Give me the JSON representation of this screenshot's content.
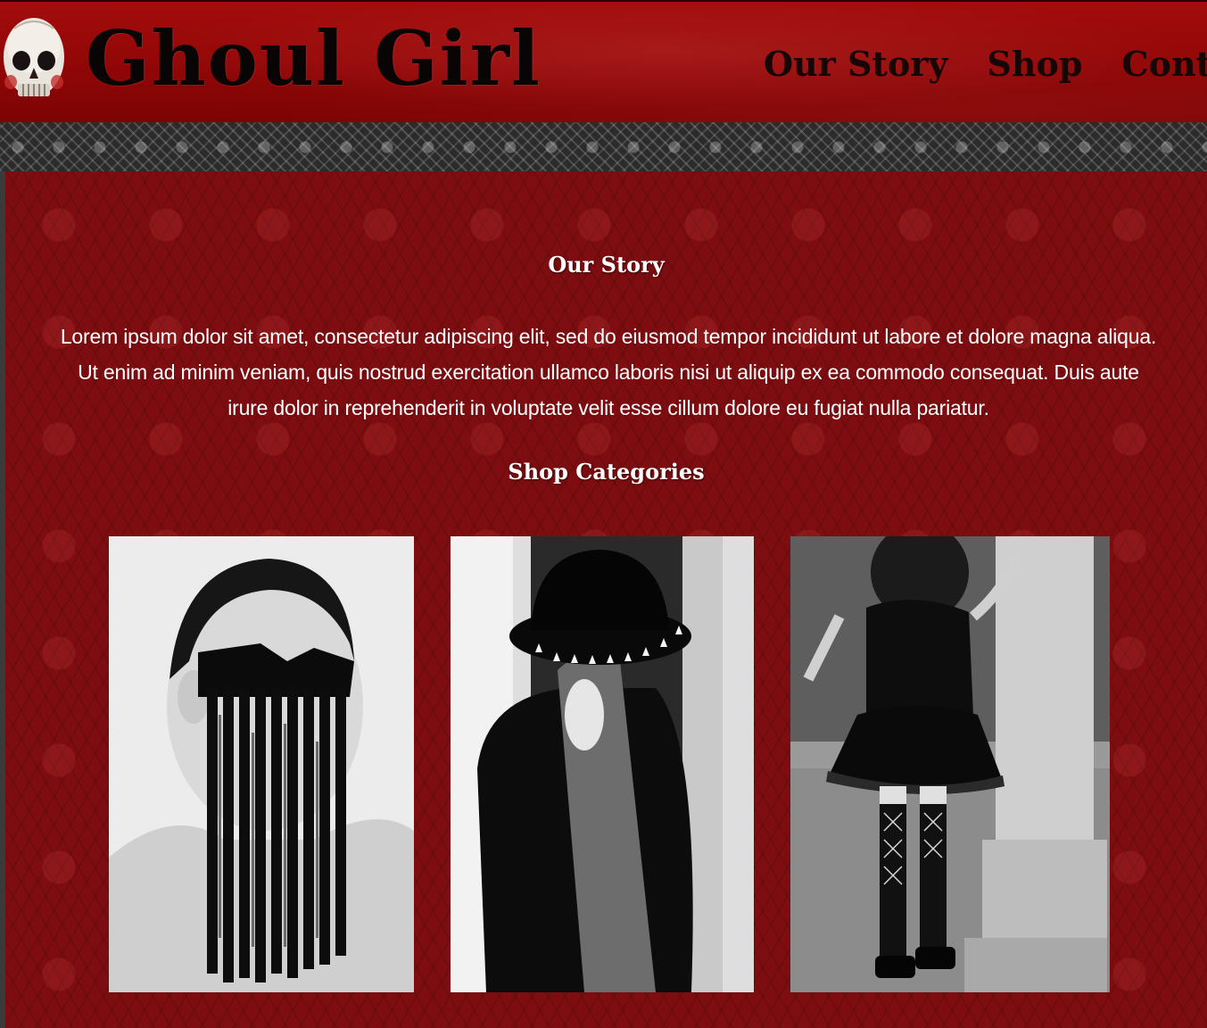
{
  "header": {
    "brand": "Ghoul Girl",
    "logo_icon": "skull-icon",
    "nav": [
      {
        "label": "Our Story"
      },
      {
        "label": "Shop"
      },
      {
        "label": "Contact"
      }
    ]
  },
  "colors": {
    "header_red": "#9a0808",
    "main_red": "#7d0d10",
    "band_grey": "#2b2b2b",
    "text_white": "#ffffff"
  },
  "story": {
    "title": "Our Story",
    "text": "Lorem ipsum dolor sit amet, consectetur adipiscing elit, sed do eiusmod tempor incididunt ut labore et dolore magna aliqua. Ut enim ad minim veniam, quis nostrud exercitation ullamco laboris nisi ut aliquip ex ea commodo consequat. Duis aute irure dolor in reprehenderit in voluptate velit esse cillum dolore eu fugiat nulla pariatur."
  },
  "shop": {
    "title": "Shop Categories",
    "categories": [
      {
        "image": "masked-woman-photo"
      },
      {
        "image": "woman-in-studded-hat-photo"
      },
      {
        "image": "woman-in-black-dress-photo"
      }
    ]
  }
}
